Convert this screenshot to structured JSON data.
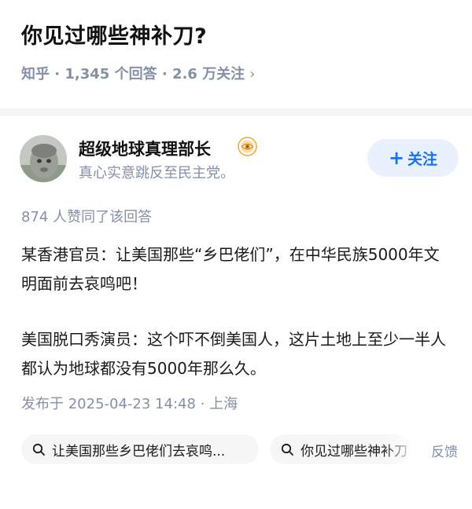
{
  "question": {
    "title": "你见过哪些神补刀?",
    "meta": "知乎 · 1,345 个回答 · 2.6 万关注",
    "chevron": "›"
  },
  "answer": {
    "author": {
      "name": "超级地球真理部长",
      "bio": "真心实意跳反至民主党。",
      "badge_icon": "eye-badge-icon"
    },
    "follow_label": "关注",
    "likes": "874 人赞同了该回答",
    "paragraphs": [
      "某香港官员：让美国那些“乡巴佬们”，在中华民族5000年文明面前去哀鸣吧！",
      "美国脱口秀演员：这个吓不倒美国人，这片土地上至少一半人都认为地球都没有5000年那么久。"
    ],
    "published": "发布于 2025-04-23 14:48 · 上海"
  },
  "related_searches": [
    "让美国那些乡巴佬们去哀鸣...",
    "你见过哪些神补刀"
  ],
  "feedback_label": "反馈",
  "colors": {
    "accent": "#1772f6",
    "follow_bg": "#e9f1fc",
    "meta_gray": "#8590a6",
    "badge_orange": "#f5a623"
  }
}
